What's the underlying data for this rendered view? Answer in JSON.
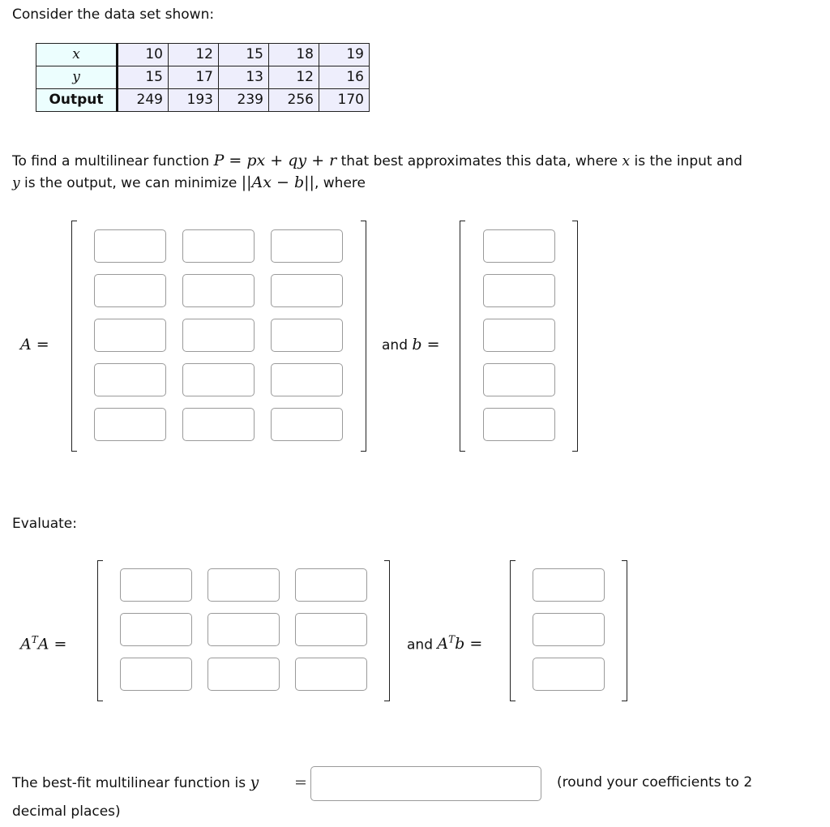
{
  "intro": "Consider the data set shown:",
  "table": {
    "row_headers": [
      "x",
      "y",
      "Output"
    ],
    "rows": [
      [
        "10",
        "12",
        "15",
        "18",
        "19"
      ],
      [
        "15",
        "17",
        "13",
        "12",
        "16"
      ],
      [
        "249",
        "193",
        "239",
        "256",
        "170"
      ]
    ]
  },
  "problem": {
    "line1_pre": "To find a multilinear function ",
    "formula": "P = px + qy + r",
    "line1_mid": " that best approximates this data, where ",
    "var_x": "x",
    "line1_post": " is the input and",
    "var_y": "y",
    "line2_mid": " is the output, we can minimize ",
    "norm": "||Ax − b||",
    "line2_post": ", where"
  },
  "matrix_A": {
    "label": "A =",
    "rows": 5,
    "cols": 3,
    "values": [
      "",
      "",
      "",
      "",
      "",
      "",
      "",
      "",
      "",
      "",
      "",
      "",
      "",
      "",
      ""
    ]
  },
  "vector_b": {
    "label_and": "and ",
    "label": "b =",
    "rows": 5,
    "values": [
      "",
      "",
      "",
      "",
      ""
    ]
  },
  "evaluate_label": "Evaluate:",
  "matrix_ATA": {
    "label_base": "A",
    "label_sup": "T",
    "label_end": "A =",
    "rows": 3,
    "cols": 3,
    "values": [
      "",
      "",
      "",
      "",
      "",
      "",
      "",
      "",
      ""
    ]
  },
  "vector_ATb": {
    "label_and": "and ",
    "label_base": "A",
    "label_sup": "T",
    "label_end": "b =",
    "rows": 3,
    "values": [
      "",
      "",
      ""
    ]
  },
  "final": {
    "prefix": "The best-fit multilinear function is ",
    "var": "y",
    "eq": "=",
    "value": "",
    "note": "(round your coefficients to 2",
    "note2": "decimal places)"
  },
  "colors": {
    "header_cell_bg": "#ecfefe",
    "data_cell_bg": "#eeeefc",
    "input_border": "#9a9a9a"
  }
}
